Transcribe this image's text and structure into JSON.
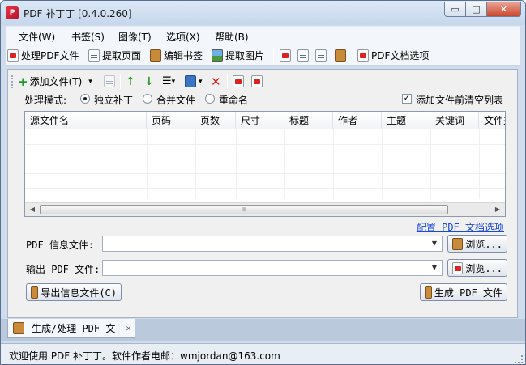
{
  "window": {
    "title": "PDF 补丁丁 [0.4.0.260]",
    "minimize": "▭",
    "maximize": "□",
    "close": "✕"
  },
  "menu": [
    "文件(W)",
    "书签(S)",
    "图像(T)",
    "选项(X)",
    "帮助(B)"
  ],
  "toolbar": {
    "process_pdf": "处理PDF文件",
    "extract_pages": "提取页面",
    "edit_bookmarks": "编辑书签",
    "extract_images": "提取图片",
    "pdf_doc_options": "PDF文档选项"
  },
  "panel_toolbar": {
    "add_files": "添加文件(T)",
    "dropdown": "▾"
  },
  "mode": {
    "label": "处理模式:",
    "options": [
      "独立补丁",
      "合并文件",
      "重命名"
    ],
    "selected": "独立补丁",
    "clear_list_label": "添加文件前清空列表",
    "clear_list_checked": true
  },
  "file_table": {
    "columns": [
      "源文件名",
      "页码",
      "页数",
      "尺寸",
      "标题",
      "作者",
      "主题",
      "关键词",
      "文件夹"
    ],
    "rows": [],
    "scroll_grip": "III"
  },
  "config_link": "配置 PDF 文档选项",
  "info_file": {
    "label": "PDF 信息文件:",
    "value": "",
    "browse": "浏览..."
  },
  "output_file": {
    "label": "输出 PDF 文件:",
    "value": "",
    "browse": "浏览..."
  },
  "export_info_button": "导出信息文件(C)",
  "generate_button": "生成 PDF 文件",
  "tab": {
    "label": "生成/处理 PDF 文",
    "close": "✕"
  },
  "status": "欢迎使用 PDF 补丁丁。软件作者电邮：wmjordan@163.com"
}
